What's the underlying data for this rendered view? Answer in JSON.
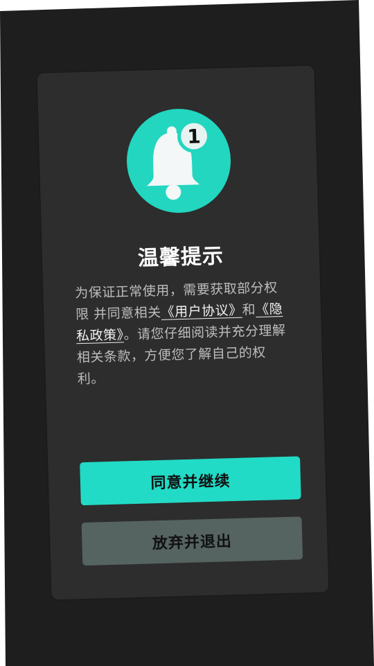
{
  "dialog": {
    "title": "温馨提示",
    "badge_count": "1",
    "body": {
      "part1": "为保证正常使用，需要获取部分权限 并同意相关",
      "user_agreement_link": "《用户协议》",
      "and": "和",
      "privacy_policy_link": "《隐私政策》",
      "part2": "。请您仔细阅读并充分理解相关条款，方便您了解自己的权利。"
    },
    "agree_button_label": "同意并继续",
    "exit_button_label": "放弃并退出"
  },
  "colors": {
    "accent": "#22dbc6",
    "dialog_background": "#2d2d2d",
    "exit_button": "#556361",
    "page_background": "#1e1e1e"
  },
  "icons": {
    "bell": "bell-icon",
    "notification_badge": "notification-count-badge"
  }
}
